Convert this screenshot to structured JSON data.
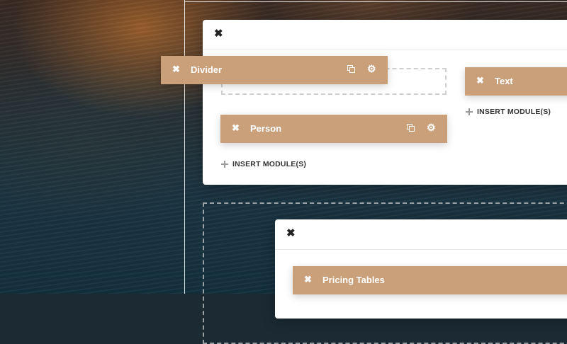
{
  "icons": {
    "close": "close-icon",
    "duplicate": "duplicate-icon",
    "settings": "gear-icon",
    "add": "plus-icon"
  },
  "glyphs": {
    "close": "✖",
    "gear": "⚙"
  },
  "colors": {
    "module_bg": "#c9a07a",
    "panel_bg": "#ffffff",
    "text_dark": "#333333"
  },
  "column_left": {
    "modules": [
      {
        "label": "Divider"
      },
      {
        "label": "Person"
      }
    ],
    "insert_label": "INSERT MODULE(S)"
  },
  "column_right": {
    "modules": [
      {
        "label": "Text"
      }
    ],
    "insert_label": "INSERT MODULE(S)"
  },
  "row_bottom": {
    "modules": [
      {
        "label": "Pricing Tables"
      }
    ]
  }
}
